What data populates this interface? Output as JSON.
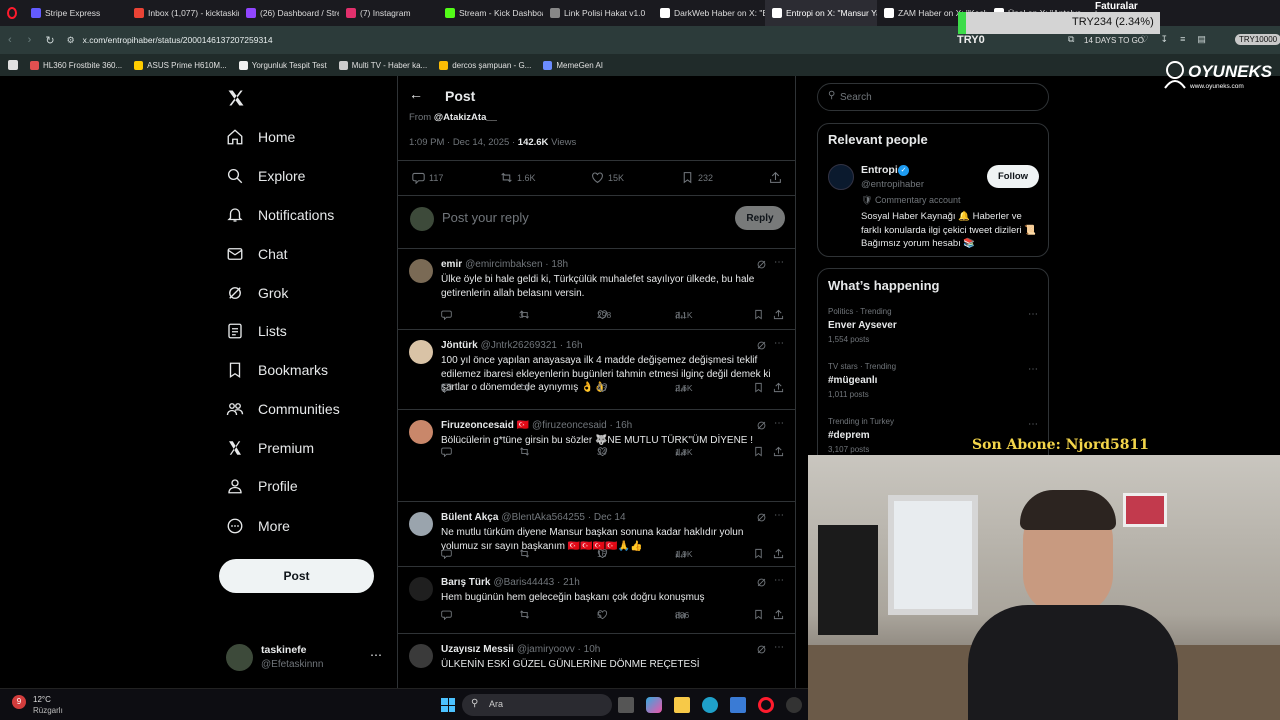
{
  "browser": {
    "tabs": [
      {
        "label": "Stripe Express",
        "color": "#635bff"
      },
      {
        "label": "Inbox (1,077) - kicktaskin",
        "color": "#ea4335"
      },
      {
        "label": "(26) Dashboard / Streaml",
        "color": "#9146ff"
      },
      {
        "label": "(7) Instagram",
        "color": "#e1306c"
      },
      {
        "label": "Stream - Kick Dashboard",
        "color": "#53fc18"
      },
      {
        "label": "Link Polisi Hakat v1.0",
        "color": "#888888"
      },
      {
        "label": "DarkWeb Haber on X: \"Ep",
        "color": "#ffffff"
      },
      {
        "label": "Entropi on X: \"Mansur Ya",
        "color": "#ffffff"
      },
      {
        "label": "ZAM Haber on X: \"Kesk",
        "color": "#ffffff"
      },
      {
        "label": "Ünal on X: \"Antalya",
        "color": "#ffffff"
      }
    ],
    "url": "x.com/entropihaber/status/2000146137207259314",
    "bookmarks": [
      {
        "label": "HL360 Frostbite 360...",
        "color": "#e05050"
      },
      {
        "label": "ASUS Prime H610M...",
        "color": "#ffcc00"
      },
      {
        "label": "Yorgunluk Tespit Test",
        "color": "#f0f0f0"
      },
      {
        "label": "Multi TV - Haber ka...",
        "color": "#cccccc"
      },
      {
        "label": "dercos şampuan - G...",
        "color": "#fbbc05"
      },
      {
        "label": "MemeGen AI",
        "color": "#6b8cff"
      }
    ]
  },
  "overlay": {
    "ticker": "TRY234 (2.34%)",
    "ticker_sub": "TRY0",
    "faturalar": "Faturalar",
    "days_to_go": "14 DAYS TO GO",
    "balance": "TRY10000",
    "sponsor_name": "OYUNEKS",
    "sponsor_url": "www.oyuneks.com",
    "last_sub": "Son Abone: Njord5811"
  },
  "nav": {
    "items": [
      {
        "label": "Home",
        "icon": "home-icon"
      },
      {
        "label": "Explore",
        "icon": "search-icon"
      },
      {
        "label": "Notifications",
        "icon": "bell-icon"
      },
      {
        "label": "Chat",
        "icon": "mail-icon"
      },
      {
        "label": "Grok",
        "icon": "grok-icon"
      },
      {
        "label": "Lists",
        "icon": "list-icon"
      },
      {
        "label": "Bookmarks",
        "icon": "bookmark-icon"
      },
      {
        "label": "Communities",
        "icon": "communities-icon"
      },
      {
        "label": "Premium",
        "icon": "x-icon"
      },
      {
        "label": "Profile",
        "icon": "person-icon"
      },
      {
        "label": "More",
        "icon": "more-circle-icon"
      }
    ],
    "post_button": "Post",
    "account_name": "taskinefe",
    "account_handle": "@Efetaskinnn"
  },
  "post": {
    "header": "Post",
    "from_label": "From",
    "from_handle": "@AtakizAta__",
    "time": "1:09 PM · Dec 14, 2025 ·",
    "views": "142.6K",
    "views_label": "Views",
    "replies": "117",
    "reposts": "1.6K",
    "likes": "15K",
    "bookmarks": "232",
    "reply_placeholder": "Post your reply",
    "reply_button": "Reply"
  },
  "replies": [
    {
      "name": "emir",
      "handle": "@emircimbaksen · 18h",
      "text": "Ülke öyle bi hale geldi ki, Türkçülük muhalefet sayılıyor ülkede, bu hale getirenlerin allah belasını versin.",
      "replies": "",
      "reposts": "3",
      "likes": "298",
      "views": "3.1K",
      "avatar": "#7a6a55"
    },
    {
      "name": "Jöntürk",
      "handle": "@Jntrk26269321 · 16h",
      "text": "100 yıl önce yapılan anayasaya ilk 4 madde değişemez değişmesi teklif edilemez ibaresi ekleyenlerin bugünleri tahmin etmesi ilginç değil demek ki şartlar o dönemde de aynıymış 👌👌",
      "replies": "1",
      "reposts": "",
      "likes": "43",
      "views": "2.6K",
      "avatar": "#d9c3a6"
    },
    {
      "name": "Firuzeoncesaid 🇹🇷",
      "handle": "@firuzeoncesaid · 16h",
      "text": "Bölücülerin g*tüne girsin bu sözler 🐺NE MUTLU TÜRK\"ÜM DİYENE !",
      "replies": "",
      "reposts": "",
      "likes": "34",
      "views": "1.8K",
      "avatar": "#c9876a"
    },
    {
      "name": "Bülent Akça",
      "handle": "@BlentAka564255 · Dec 14",
      "text": "Ne mutlu türküm diyene Mansur başkan sonuna kadar haklıdır  yolun yolumuz sır sayın başkanım 🇹🇷🇹🇷🇹🇷🇹🇷🙏👍",
      "replies": "",
      "reposts": "",
      "likes": "16",
      "views": "1.9K",
      "avatar": "#9aa4ad"
    },
    {
      "name": "Barış Türk",
      "handle": "@Baris44443 · 21h",
      "text": "Hem bugünün hem geleceğin başkanı çok doğru konuşmuş",
      "replies": "",
      "reposts": "",
      "likes": "5",
      "views": "886",
      "avatar": "#1f1f1f"
    },
    {
      "name": "Uzayısız Messii",
      "handle": "@jamiryoovv · 10h",
      "text": "ÜLKENİN ESKİ GÜZEL GÜNLERİNE DÖNME REÇETESİ",
      "replies": "",
      "reposts": "",
      "likes": "",
      "views": "",
      "avatar": "#3a3a3a"
    }
  ],
  "right": {
    "search_placeholder": "Search",
    "relevant_title": "Relevant people",
    "person_name": "Entropi",
    "person_handle": "@entropihaber",
    "person_tag": "Commentary account",
    "person_bio": "Sosyal Haber Kaynağı 🔔 Haberler ve farklı konularda ilgi çekici tweet dizileri 📜 Bağımsız yorum hesabı 📚",
    "follow_button": "Follow",
    "happening_title": "What’s happening",
    "trends": [
      {
        "category": "Politics · Trending",
        "title": "Enver Aysever",
        "posts": "1,554 posts"
      },
      {
        "category": "TV stars · Trending",
        "title": "#mügeanlı",
        "posts": "1,011 posts"
      },
      {
        "category": "Trending in Turkey",
        "title": "#deprem",
        "posts": "3,107 posts"
      }
    ]
  },
  "taskbar": {
    "weather_temp": "12°C",
    "weather_desc": "Rüzgarlı",
    "search_placeholder": "Ara"
  }
}
